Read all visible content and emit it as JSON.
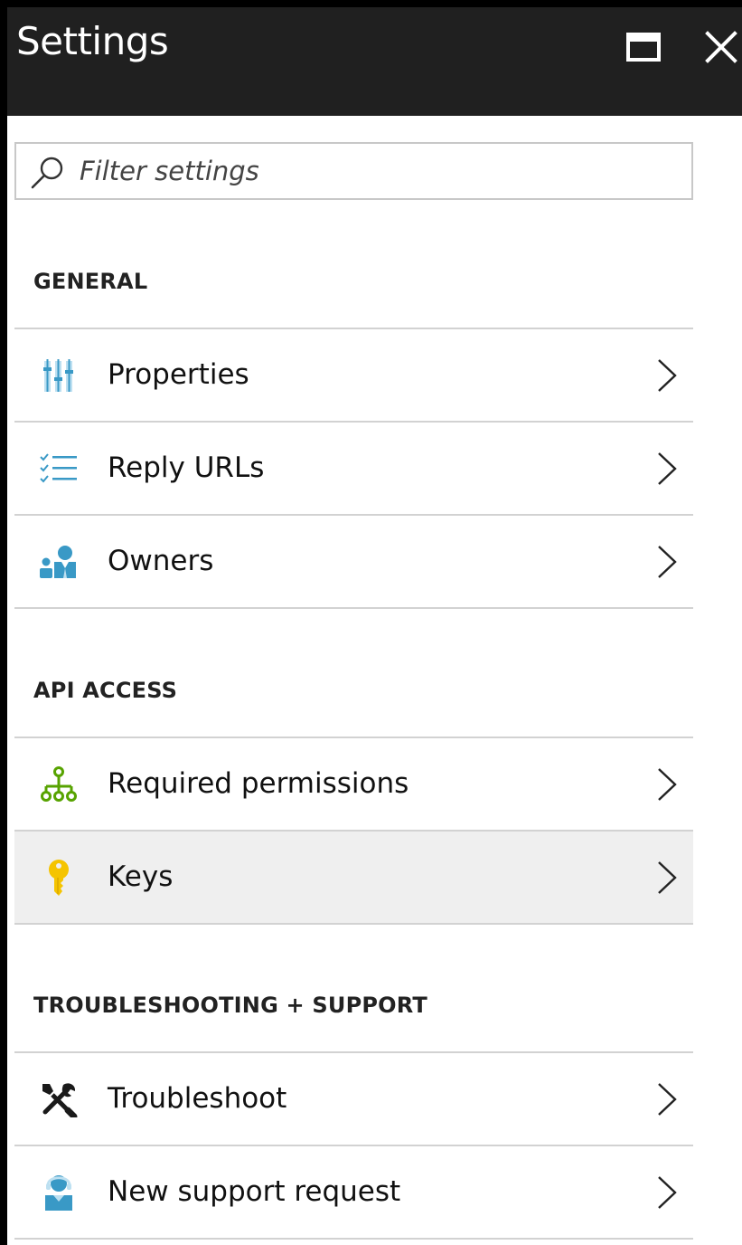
{
  "window": {
    "title": "Settings",
    "maximize_icon": "maximize-icon",
    "close_icon": "close-icon"
  },
  "search": {
    "placeholder": "Filter settings",
    "value": "",
    "icon": "search-icon"
  },
  "sections": [
    {
      "title": "GENERAL",
      "items": [
        {
          "label": "Properties",
          "icon": "properties-icon"
        },
        {
          "label": "Reply URLs",
          "icon": "list-check-icon"
        },
        {
          "label": "Owners",
          "icon": "owners-icon"
        }
      ]
    },
    {
      "title": "API ACCESS",
      "items": [
        {
          "label": "Required permissions",
          "icon": "hierarchy-icon"
        },
        {
          "label": "Keys",
          "icon": "key-icon",
          "selected": true
        }
      ]
    },
    {
      "title": "TROUBLESHOOTING + SUPPORT",
      "items": [
        {
          "label": "Troubleshoot",
          "icon": "wrench-screwdriver-icon"
        },
        {
          "label": "New support request",
          "icon": "support-person-icon"
        }
      ]
    }
  ],
  "colors": {
    "header_bg": "#202020",
    "icon_blue": "#3999c6",
    "icon_green": "#57a300",
    "icon_yellow": "#f5c400",
    "selected_bg": "#efefef"
  }
}
